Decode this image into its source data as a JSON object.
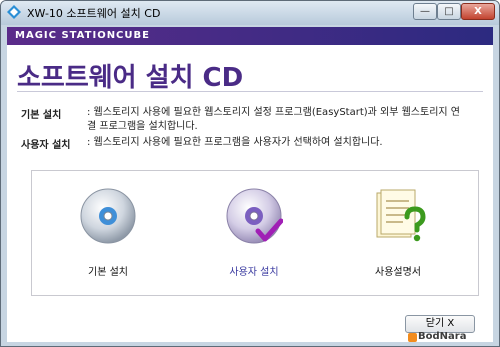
{
  "window": {
    "title": "XW-10 소프트웨어 설치 CD",
    "minimize_glyph": "—",
    "maximize_glyph": "□",
    "close_glyph": "X"
  },
  "brand": {
    "logo_text": "MAGIC STATIONCUBE"
  },
  "main": {
    "heading": "소프트웨어 설치 CD",
    "descriptions": [
      {
        "label": "기본 설치",
        "text": ": 웹스토리지 사용에 필요한 웹스토리지 설정 프로그램(EasyStart)과 외부 웹스토리지 연결 프로그램을 설치합니다."
      },
      {
        "label": "사용자 설치",
        "text": ": 웹스토리지 사용에 필요한 프로그램을 사용자가 선택하여 설치합니다."
      }
    ],
    "options": [
      {
        "label": "기본 설치",
        "icon": "cd-icon"
      },
      {
        "label": "사용자 설치",
        "icon": "cd-check-icon",
        "highlighted": true
      },
      {
        "label": "사용설명서",
        "icon": "manual-help-icon"
      }
    ]
  },
  "footer": {
    "close_label": "닫기 X"
  },
  "watermark": {
    "text": "BodNara"
  },
  "colors": {
    "accent": "#4a2b86",
    "brand_bar": "#2c2a80"
  }
}
